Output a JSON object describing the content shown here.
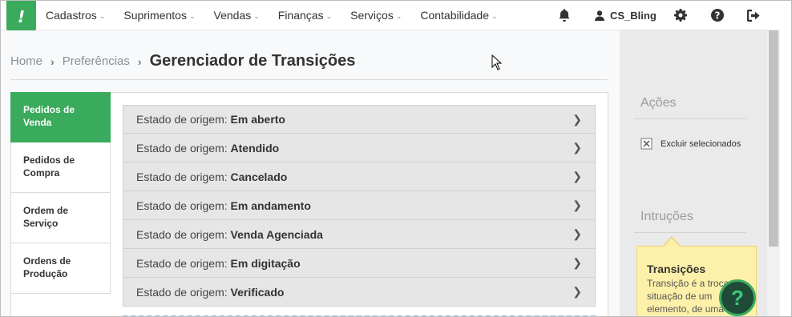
{
  "nav": {
    "logo_text": "!",
    "menu": [
      {
        "label": "Cadastros"
      },
      {
        "label": "Suprimentos"
      },
      {
        "label": "Vendas"
      },
      {
        "label": "Finanças"
      },
      {
        "label": "Serviços"
      },
      {
        "label": "Contabilidade"
      }
    ],
    "user_name": "CS_Bling",
    "icons": [
      "bell-icon",
      "user-icon",
      "gear-icon",
      "help-icon",
      "logout-icon"
    ]
  },
  "breadcrumb": {
    "home": "Home",
    "preferences": "Preferências",
    "current": "Gerenciador de Transições"
  },
  "tabs": [
    {
      "label": "Pedidos de Venda",
      "active": true
    },
    {
      "label": "Pedidos de Compra",
      "active": false
    },
    {
      "label": "Ordem de Serviço",
      "active": false
    },
    {
      "label": "Ordens de Produção",
      "active": false
    }
  ],
  "rows": {
    "prefix": "Estado de origem:",
    "items": [
      "Em aberto",
      "Atendido",
      "Cancelado",
      "Em andamento",
      "Venda Agenciada",
      "Em digitação",
      "Verificado"
    ]
  },
  "side": {
    "actions_title": "Ações",
    "delete_selected": "Excluir selecionados",
    "instructions_title": "Intruções",
    "help_title": "Transições",
    "help_text": "Transição é a troca de situação de um elemento, de uma"
  },
  "help_fab": "?",
  "colors": {
    "accent": "#3aaa5c",
    "row_bg": "#e6e6e6",
    "note_bg": "#fdf0a9"
  }
}
